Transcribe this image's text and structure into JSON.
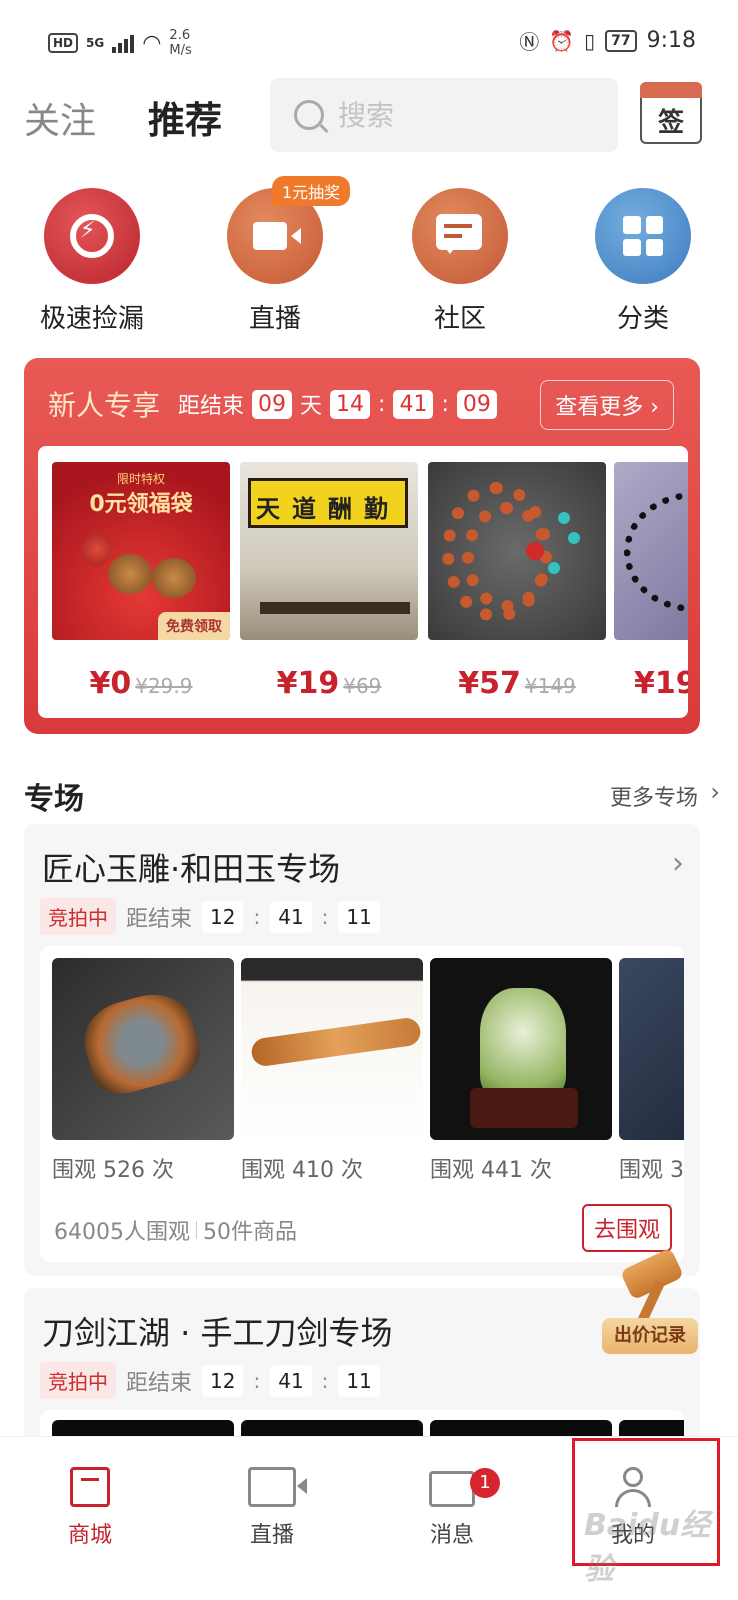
{
  "status_bar": {
    "hd": "HD",
    "network": "5G",
    "speed": "2.6\nM/s",
    "battery": "77",
    "time": "9:18"
  },
  "header": {
    "tab_follow": "关注",
    "tab_recommend": "推荐",
    "search_placeholder": "搜索",
    "sign_label": "签"
  },
  "quick_actions": [
    {
      "label": "极速捡漏",
      "icon": "alarm-lightning-icon"
    },
    {
      "label": "直播",
      "icon": "live-camera-icon",
      "badge": "1元抽奖"
    },
    {
      "label": "社区",
      "icon": "chat-bubble-icon"
    },
    {
      "label": "分类",
      "icon": "grid-category-icon"
    }
  ],
  "promo": {
    "title": "新人专享",
    "ends_label": "距结束",
    "days": "09",
    "day_unit": "天",
    "hours": "14",
    "minutes": "41",
    "seconds": "09",
    "more": "查看更多 ›",
    "items": [
      {
        "price": "¥0",
        "old": "¥29.9",
        "img_text1": "限时特权",
        "img_text2": "0元领福袋",
        "img_text3": "免费领取"
      },
      {
        "price": "¥19",
        "old": "¥69",
        "img_text": "天道酬勤"
      },
      {
        "price": "¥57",
        "old": "¥149"
      },
      {
        "price": "¥19",
        "old": ""
      }
    ]
  },
  "section": {
    "title": "专场",
    "more": "更多专场"
  },
  "zones": [
    {
      "name": "匠心玉雕·和田玉专场",
      "status": "竞拍中",
      "ends_label": "距结束",
      "h": "12",
      "m": "41",
      "s": "11",
      "items": [
        {
          "views": "围观 526 次"
        },
        {
          "views": "围观 410 次"
        },
        {
          "views": "围观 441 次"
        },
        {
          "views": "围观 3"
        }
      ],
      "watchers": "64005人围观",
      "goods": "50件商品",
      "go": "去围观"
    },
    {
      "name": "刀剑江湖 · 手工刀剑专场",
      "status": "竞拍中",
      "ends_label": "距结束",
      "h": "12",
      "m": "41",
      "s": "11"
    }
  ],
  "bid_record": "出价记录",
  "bottom_nav": {
    "items": [
      {
        "label": "商城",
        "active": true
      },
      {
        "label": "直播"
      },
      {
        "label": "消息",
        "badge": "1"
      },
      {
        "label": "我的"
      }
    ]
  },
  "watermark": "Baidu经验",
  "colors": {
    "brand_red": "#c8232c",
    "promo_bg": "#e04a4a"
  }
}
